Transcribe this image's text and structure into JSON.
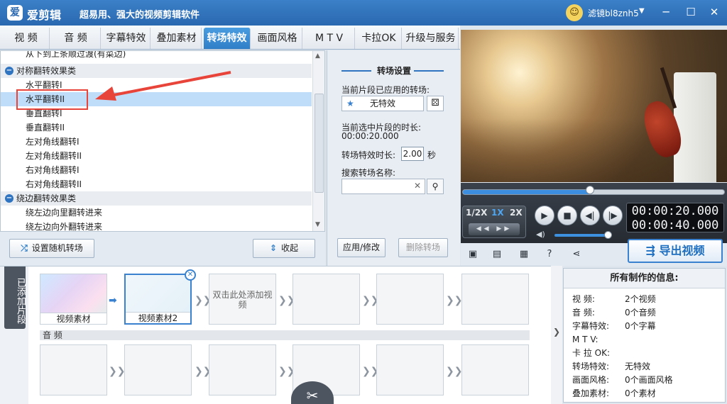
{
  "titlebar": {
    "app_logo": "爱",
    "app_name": "爱剪辑",
    "slogan": "超易用、强大的视频剪辑软件",
    "user_name": "滤镜bl8znh5",
    "minimize": "─",
    "maximize": "☐",
    "close": "✕"
  },
  "tabs": [
    {
      "label": "视 频",
      "active": false
    },
    {
      "label": "音 频",
      "active": false
    },
    {
      "label": "字幕特效",
      "active": false
    },
    {
      "label": "叠加素材",
      "active": false
    },
    {
      "label": "转场特效",
      "active": true
    },
    {
      "label": "画面风格",
      "active": false
    },
    {
      "label": "M T V",
      "active": false
    },
    {
      "label": "卡拉OK",
      "active": false
    },
    {
      "label": "升级与服务",
      "active": false
    }
  ],
  "effects_list": {
    "rows": [
      {
        "type": "item",
        "label": "从下到上条顺过渡(有菜边)"
      },
      {
        "type": "group",
        "label": "对称翻转效果类"
      },
      {
        "type": "item",
        "label": "水平翻转I"
      },
      {
        "type": "item",
        "label": "水平翻转II",
        "selected": true
      },
      {
        "type": "item",
        "label": "垂直翻转I"
      },
      {
        "type": "item",
        "label": "垂直翻转II"
      },
      {
        "type": "item",
        "label": "左对角线翻转I"
      },
      {
        "type": "item",
        "label": "左对角线翻转II"
      },
      {
        "type": "item",
        "label": "右对角线翻转I"
      },
      {
        "type": "item",
        "label": "右对角线翻转II"
      },
      {
        "type": "group",
        "label": "绕边翻转效果类"
      },
      {
        "type": "item",
        "label": "绕左边向里翻转进来"
      },
      {
        "type": "item",
        "label": "绕左边向外翻转进来"
      }
    ],
    "random_button": "设置随机转场",
    "collapse_button": "收起"
  },
  "settings": {
    "title": "转场设置",
    "applied_label": "当前片段已应用的转场:",
    "applied_value": "无特效",
    "duration_label": "当前选中片段的时长:",
    "duration_value": "00:00:20.000",
    "effect_duration_label": "转场特效时长:",
    "effect_duration_value": "2.00",
    "effect_duration_unit": "秒",
    "search_label": "搜索转场名称:",
    "search_value": "",
    "apply_button": "应用/修改",
    "delete_button": "删除转场"
  },
  "player": {
    "speeds": [
      "1/2X",
      "1X",
      "2X"
    ],
    "active_speed": "1X",
    "current_time": "00:00:20.000",
    "total_time": "00:00:40.000",
    "progress": 0.49,
    "volume": 0.9
  },
  "toolbar": {
    "export_button": "导出视频"
  },
  "timeline": {
    "side_label": "已添加片段",
    "clips": [
      {
        "label": "视频素材",
        "state": "filled"
      },
      {
        "label": "视频素材2",
        "state": "selected"
      },
      {
        "hint": "双击此处添加视频",
        "state": "empty"
      }
    ],
    "audio_label": "音 频"
  },
  "info": {
    "title": "所有制作的信息:",
    "rows": [
      {
        "k": "视    频:",
        "v": "2个视频"
      },
      {
        "k": "音    频:",
        "v": "0个音频"
      },
      {
        "k": "字幕特效:",
        "v": "0个字幕"
      },
      {
        "k": "M T V:",
        "v": ""
      },
      {
        "k": "卡 拉 OK:",
        "v": ""
      },
      {
        "k": "转场特效:",
        "v": "无特效"
      },
      {
        "k": "画面风格:",
        "v": "0个画面风格"
      },
      {
        "k": "叠加素材:",
        "v": "0个素材"
      }
    ]
  },
  "colors": {
    "accent": "#2f7fc8",
    "selection": "#bfdcf8",
    "annotation_red": "#e8443a"
  }
}
